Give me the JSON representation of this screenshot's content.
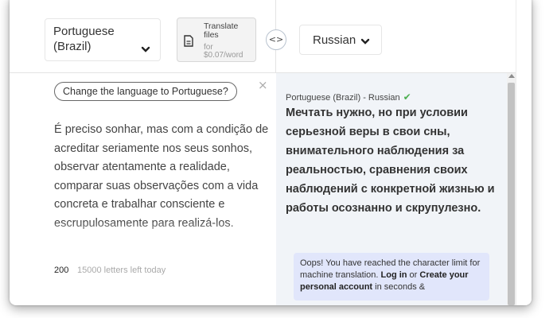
{
  "header": {
    "source_language": "Portuguese (Brazil)",
    "translate_files": {
      "title": "Translate files",
      "price": "for $0.07/word"
    },
    "swap_icon": "<>",
    "target_language": "Russian"
  },
  "source": {
    "language_suggestion": "Change the language to Portuguese?",
    "close": "×",
    "text": "É preciso sonhar, mas com a condição de acreditar seriamente nos seus sonhos, observar atentamente a realidade, comparar suas observações com a vida concreta e trabalhar consciente e escrupulosamente para realizá-los.",
    "char_count": "200",
    "letters_left": "15000 letters left today"
  },
  "target": {
    "language_pair": "Portuguese (Brazil) - Russian",
    "check_icon": "✔",
    "text": "Мечтать нужно, но при условии серьезной веры в свои сны, внимательного наблюдения за реальностью, сравнения своих наблюдений с конкретной жизнью и работы осознанно и скрупулезно.",
    "notice": {
      "part1": "Oops! You have reached the character limit for machine translation. ",
      "login": "Log in",
      "part2": " or ",
      "create": "Create your personal account",
      "part3": " in seconds &"
    }
  },
  "colors": {
    "right_pane_bg": "#f1f4f8",
    "notice_bg": "#e1e6fb",
    "check_green": "#4caf50"
  }
}
